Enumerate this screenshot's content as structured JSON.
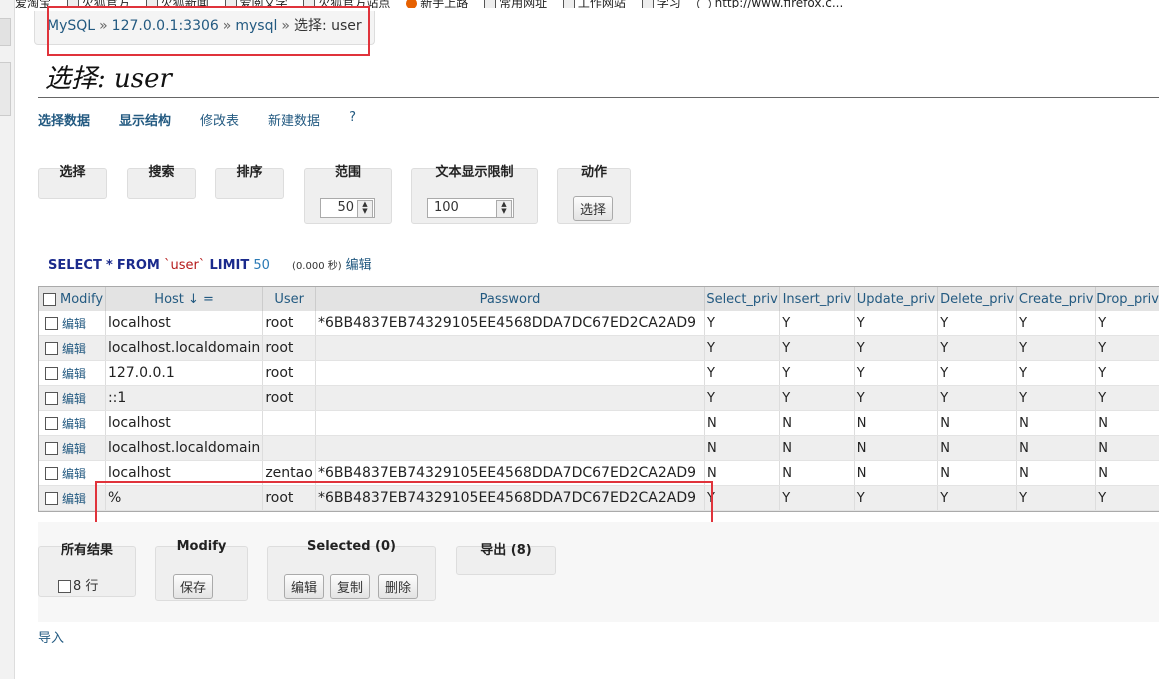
{
  "bookmarks": [
    "爱淘宝",
    "火狐官方",
    "火狐新闻",
    "爱阅文学",
    "火狐官方站点",
    "新手上路",
    "常用网址",
    "工作网站",
    "学习",
    "http://www.firefox.c..."
  ],
  "breadcrumb": {
    "server": "MySQL",
    "host": "127.0.0.1:3306",
    "database": "mysql",
    "separator": "»",
    "current": "选择: user"
  },
  "page_title": "选择: user",
  "tabs": [
    "选择数据",
    "显示结构",
    "修改表",
    "新建数据",
    "?"
  ],
  "controls": {
    "select_label": "选择",
    "search_label": "搜索",
    "sort_label": "排序",
    "range_label": "范围",
    "range_value": "50",
    "text_limit_label": "文本显示限制",
    "text_limit_value": "100",
    "action_label": "动作",
    "action_button": "选择"
  },
  "query": {
    "select": "SELECT",
    "star": "*",
    "from": "FROM",
    "table": "`user`",
    "limit": "LIMIT",
    "limit_value": "50",
    "time": "(0.000 秒)",
    "edit_link": "编辑"
  },
  "table": {
    "modify_header": "Modify",
    "columns": [
      "Host ↓ =",
      "User",
      "Password",
      "Select_priv",
      "Insert_priv",
      "Update_priv",
      "Delete_priv",
      "Create_priv",
      "Drop_priv"
    ],
    "edit_label": "编辑",
    "rows": [
      [
        "localhost",
        "root",
        "*6BB4837EB74329105EE4568DDA7DC67ED2CA2AD9",
        "Y",
        "Y",
        "Y",
        "Y",
        "Y",
        "Y"
      ],
      [
        "localhost.localdomain",
        "root",
        "",
        "Y",
        "Y",
        "Y",
        "Y",
        "Y",
        "Y"
      ],
      [
        "127.0.0.1",
        "root",
        "",
        "Y",
        "Y",
        "Y",
        "Y",
        "Y",
        "Y"
      ],
      [
        "::1",
        "root",
        "",
        "Y",
        "Y",
        "Y",
        "Y",
        "Y",
        "Y"
      ],
      [
        "localhost",
        "",
        "",
        "N",
        "N",
        "N",
        "N",
        "N",
        "N"
      ],
      [
        "localhost.localdomain",
        "",
        "",
        "N",
        "N",
        "N",
        "N",
        "N",
        "N"
      ],
      [
        "localhost",
        "zentao",
        "*6BB4837EB74329105EE4568DDA7DC67ED2CA2AD9",
        "N",
        "N",
        "N",
        "N",
        "N",
        "N"
      ],
      [
        "%",
        "root",
        "*6BB4837EB74329105EE4568DDA7DC67ED2CA2AD9",
        "Y",
        "Y",
        "Y",
        "Y",
        "Y",
        "Y"
      ]
    ]
  },
  "bottom": {
    "all_results_label": "所有结果",
    "rows_count": "8 行",
    "modify_label": "Modify",
    "save_button": "保存",
    "selected_label": "Selected (0)",
    "edit_button": "编辑",
    "copy_button": "复制",
    "delete_button": "删除",
    "export_label": "导出 (8)",
    "import_link": "导入"
  },
  "colors": {
    "link": "#235a81",
    "highlight_box": "#e0333b",
    "keyword": "#1a2a8c",
    "string": "#b51a1a"
  }
}
